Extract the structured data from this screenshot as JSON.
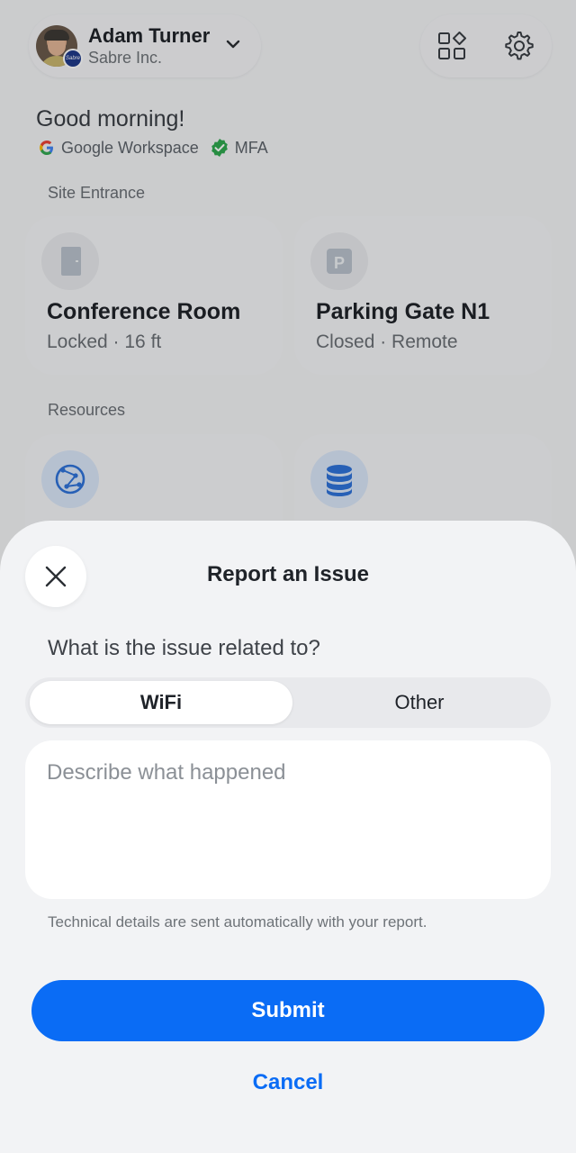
{
  "header": {
    "user_name": "Adam Turner",
    "org_name": "Sabre Inc.",
    "org_badge": "Sabre"
  },
  "greeting": "Good morning!",
  "auth": {
    "provider": "Google Workspace",
    "mfa": "MFA"
  },
  "site_entrance": {
    "label": "Site Entrance",
    "cards": [
      {
        "title": "Conference Room",
        "subtitle": "Locked · 16 ft",
        "icon": "door-icon"
      },
      {
        "title": "Parking Gate N1",
        "subtitle": "Closed · Remote",
        "icon": "parking-icon",
        "icon_glyph": "P"
      }
    ]
  },
  "resources": {
    "label": "Resources",
    "cards": [
      {
        "icon": "network-globe-icon"
      },
      {
        "icon": "database-icon"
      }
    ]
  },
  "sheet": {
    "title": "Report an Issue",
    "question": "What is the issue related to?",
    "options": [
      "WiFi",
      "Other"
    ],
    "selected": "WiFi",
    "description_placeholder": "Describe what happened",
    "note": "Technical details are sent automatically with your report.",
    "submit_label": "Submit",
    "cancel_label": "Cancel"
  },
  "colors": {
    "accent": "#0a6cf5",
    "mfa_green": "#2fa84f",
    "resource_blue": "#2f73d9"
  }
}
